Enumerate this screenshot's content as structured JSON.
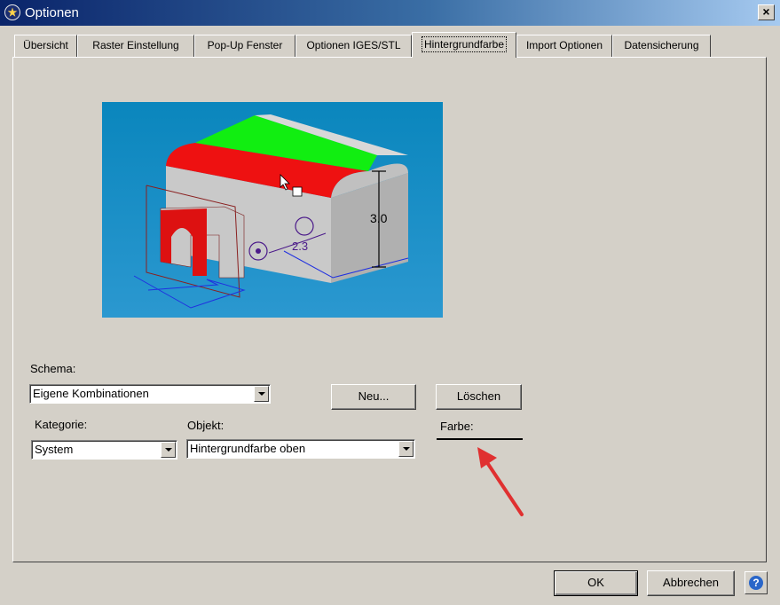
{
  "window": {
    "title": "Optionen",
    "close_label": "×"
  },
  "tabs": [
    {
      "label": "Übersicht",
      "active": false
    },
    {
      "label": "Raster Einstellung",
      "active": false
    },
    {
      "label": "Pop-Up Fenster",
      "active": false
    },
    {
      "label": "Optionen IGES/STL",
      "active": false
    },
    {
      "label": "Hintergrundfarbe",
      "active": true
    },
    {
      "label": "Import Optionen",
      "active": false
    },
    {
      "label": "Datensicherung",
      "active": false
    }
  ],
  "preview": {
    "dim_height": "3.0",
    "dim_radius": "2.3"
  },
  "form": {
    "schema_label": "Schema:",
    "schema_value": "Eigene Kombinationen",
    "kategorie_label": "Kategorie:",
    "kategorie_value": "System",
    "objekt_label": "Objekt:",
    "objekt_value": "Hintergrundfarbe oben",
    "farbe_label": "Farbe:",
    "new_button": "Neu...",
    "delete_button": "Löschen"
  },
  "footer": {
    "ok": "OK",
    "cancel": "Abbrechen",
    "help": "?"
  },
  "colors": {
    "preview_bg": "#1f8ac2",
    "annotation_arrow": "#e03030",
    "title_gradient_start": "#0a246a"
  }
}
